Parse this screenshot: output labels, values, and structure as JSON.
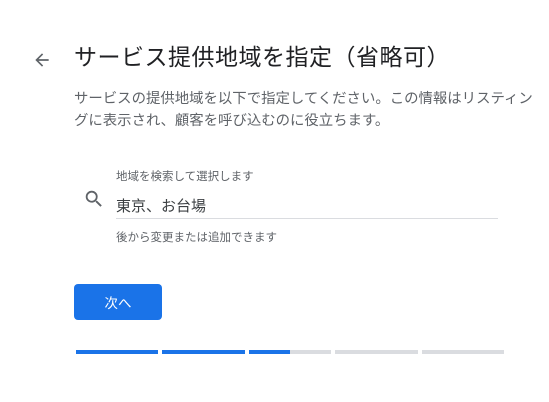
{
  "header": {
    "back_icon": "arrow-left-icon",
    "title": "サービス提供地域を指定（省略可）"
  },
  "description": "サービスの提供地域を以下で指定してください。この情報はリスティングに表示され、顧客を呼び込むのに役立ちます。",
  "search": {
    "icon": "search-icon",
    "label": "地域を検索して選択します",
    "value": "東京、お台場",
    "helper": "後から変更または追加できます"
  },
  "actions": {
    "next_label": "次へ"
  },
  "progress": {
    "segments": [
      1.0,
      1.0,
      0.5,
      0.0,
      0.0
    ]
  },
  "colors": {
    "accent": "#1a73e8",
    "title_text": "#202124",
    "secondary_text": "#5f6368",
    "divider": "#dadce0"
  }
}
